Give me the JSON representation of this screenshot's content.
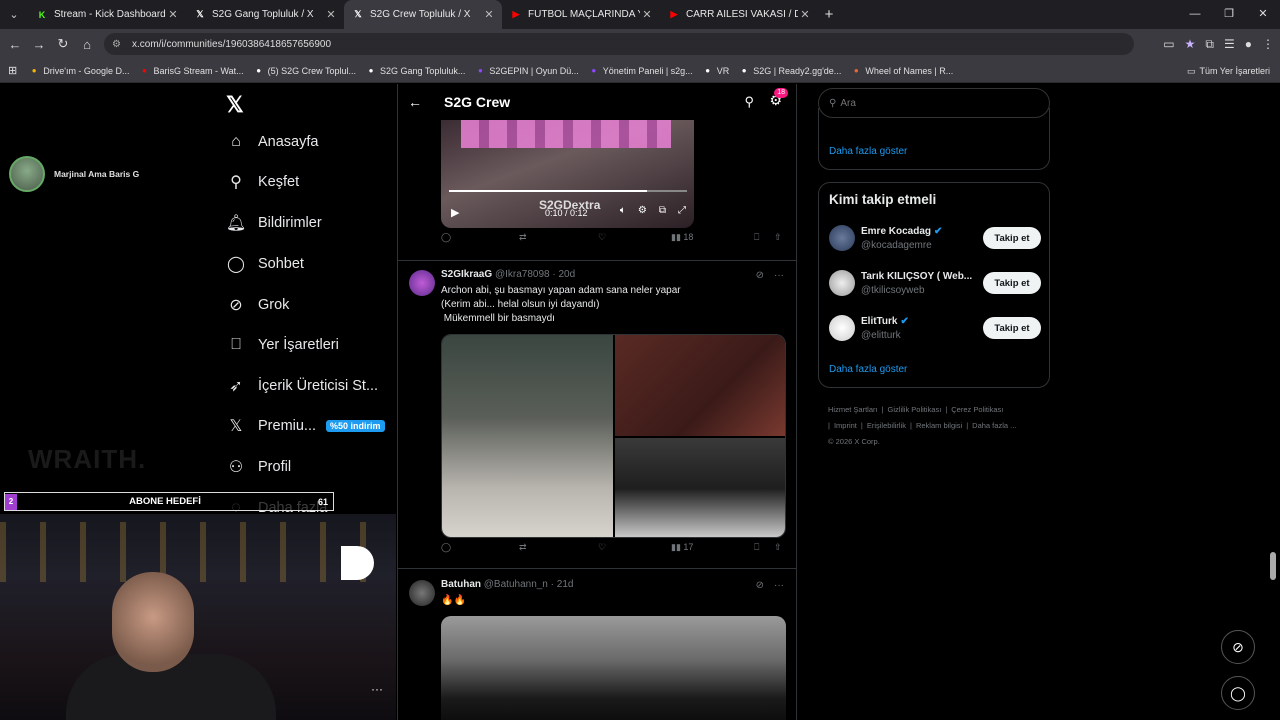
{
  "browser": {
    "tabs": [
      {
        "title": "Stream - Kick Dashboard",
        "icon": "kick-icon",
        "color": "#53fc18",
        "glyph": "K",
        "active": false
      },
      {
        "title": "S2G Gang Topluluk / X",
        "icon": "x-icon",
        "color": "#ffffff",
        "glyph": "𝕏",
        "active": false
      },
      {
        "title": "S2G Crew Topluluk / X",
        "icon": "x-icon",
        "color": "#ffffff",
        "glyph": "𝕏",
        "active": true
      },
      {
        "title": "FUTBOL MAÇLARINDA YAŞANAN",
        "icon": "youtube-icon",
        "color": "#ff0000",
        "glyph": "▶",
        "active": false
      },
      {
        "title": "CARR AİLESİ VAKASI / DEDEKTİ",
        "icon": "youtube-icon",
        "color": "#ff0000",
        "glyph": "▶",
        "active": false
      }
    ],
    "url": "x.com/i/communities/1960386418657656900",
    "bookmarks": [
      {
        "label": "Drive'ım - Google D...",
        "icon": "drive-icon",
        "color": "#f4b400"
      },
      {
        "label": "BarisG Stream - Wat...",
        "icon": "youtube-icon",
        "color": "#ff0000"
      },
      {
        "label": "(5) S2G Crew Toplul...",
        "icon": "x-icon",
        "color": "#ffffff"
      },
      {
        "label": "S2G Gang Topluluk...",
        "icon": "x-icon",
        "color": "#ffffff"
      },
      {
        "label": "S2GEPIN | Oyun Dü...",
        "icon": "twitch-icon",
        "color": "#9146ff"
      },
      {
        "label": "Yönetim Paneli | s2g...",
        "icon": "twitch-icon",
        "color": "#9146ff"
      },
      {
        "label": "VR",
        "icon": "vr-icon",
        "color": "#ffffff"
      },
      {
        "label": "S2G | Ready2.gg'de...",
        "icon": "globe-icon",
        "color": "#ffffff"
      },
      {
        "label": "Wheel of Names | R...",
        "icon": "wheel-icon",
        "color": "#e63"
      }
    ],
    "all_bookmarks": "Tüm Yer İşaretleri"
  },
  "nav": {
    "items": [
      {
        "label": "Anasayfa",
        "icon": "home-icon",
        "glyph": "⌂"
      },
      {
        "label": "Keşfet",
        "icon": "search-icon",
        "glyph": "⚲"
      },
      {
        "label": "Bildirimler",
        "icon": "bell-icon",
        "glyph": "🔔︎"
      },
      {
        "label": "Sohbet",
        "icon": "chat-icon",
        "glyph": "◯"
      },
      {
        "label": "Grok",
        "icon": "grok-icon",
        "glyph": "⊘"
      },
      {
        "label": "Yer İşaretleri",
        "icon": "bookmark-icon",
        "glyph": "⎕"
      },
      {
        "label": "İçerik Üreticisi St...",
        "icon": "rocket-icon",
        "glyph": "➶"
      },
      {
        "label": "Premiu...",
        "icon": "x-premium-icon",
        "glyph": "𝕏"
      },
      {
        "label": "Profil",
        "icon": "person-icon",
        "glyph": "⚇"
      },
      {
        "label": "Daha fazla",
        "icon": "more-circle-icon",
        "glyph": "◌"
      }
    ],
    "premium_badge": "%50 indirim"
  },
  "main": {
    "title": "S2G Crew",
    "notif_count": "18",
    "video": {
      "time": "0:10 / 0:12",
      "watermark": "S2GDextra",
      "progress": 0.83
    },
    "posts": [
      {
        "name": "S2GIkraaG",
        "handle": "@Ikra78098",
        "age": "20d",
        "lines": [
          "Archon abi, şu basmayı yapan adam sana neler yapar",
          "(Kerim abi... helal olsun iyi dayandı)",
          " Mükemmell bir basmaydı"
        ],
        "views": "17"
      },
      {
        "name": "Batuhan",
        "handle": "@Batuhann_n",
        "age": "21d",
        "lines": [
          "🔥🔥"
        ]
      }
    ],
    "first_views": "18"
  },
  "right": {
    "search_placeholder": "Ara",
    "show_more": "Daha fazla göster",
    "follow_title": "Kimi takip etmeli",
    "follow": [
      {
        "name": "Emre Kocadag",
        "handle": "@kocadagemre",
        "verified": true
      },
      {
        "name": "Tarık KILIÇSOY ( Web...",
        "handle": "@tkilicsoyweb",
        "verified": false
      },
      {
        "name": "ElitTurk",
        "handle": "@elitturk",
        "verified": true
      }
    ],
    "follow_button": "Takip et",
    "footer": [
      "Hizmet Şartları",
      "|",
      "Gizlilik Politikası",
      "|",
      "Çerez Politikası",
      "|",
      "Imprint",
      "|",
      "Erişilebilirlik",
      "|",
      "Reklam bilgisi",
      "|",
      "Daha fazla ...",
      "© 2026 X Corp."
    ]
  },
  "overlay": {
    "profile_name": "Marjinal Ama Baris G",
    "brand": "WRAITH.",
    "goal": {
      "label": "ABONE HEDEFİ",
      "current": "2",
      "target": "61"
    }
  },
  "colors": {
    "accent": "#1d9bf0",
    "badge_pink": "#f91880",
    "goal_purple": "#a03ed0"
  }
}
